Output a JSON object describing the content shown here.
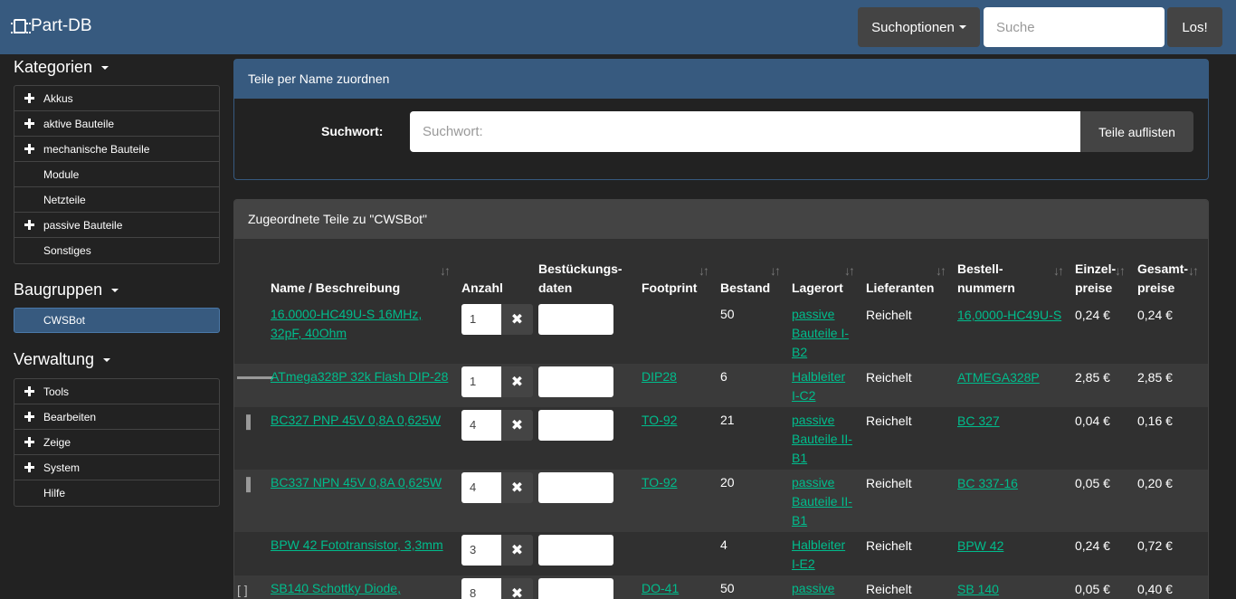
{
  "navbar": {
    "brand": "Part-DB",
    "search_options_label": "Suchoptionen",
    "search_placeholder": "Suche",
    "go_label": "Los!"
  },
  "sidebar": {
    "categories_title": "Kategorien",
    "categories": [
      {
        "label": "Akkus",
        "expandable": true
      },
      {
        "label": "aktive Bauteile",
        "expandable": true
      },
      {
        "label": "mechanische Bauteile",
        "expandable": true
      },
      {
        "label": "Module",
        "expandable": false
      },
      {
        "label": "Netzteile",
        "expandable": false
      },
      {
        "label": "passive Bauteile",
        "expandable": true
      },
      {
        "label": "Sonstiges",
        "expandable": false
      }
    ],
    "assemblies_title": "Baugruppen",
    "assemblies": [
      {
        "label": "CWSBot",
        "active": true
      }
    ],
    "admin_title": "Verwaltung",
    "admin": [
      {
        "label": "Tools",
        "expandable": true
      },
      {
        "label": "Bearbeiten",
        "expandable": true
      },
      {
        "label": "Zeige",
        "expandable": true
      },
      {
        "label": "System",
        "expandable": true
      },
      {
        "label": "Hilfe",
        "expandable": false
      }
    ]
  },
  "assign_panel": {
    "title": "Teile per Name zuordnen",
    "search_label": "Suchwort:",
    "search_placeholder": "Suchwort:",
    "list_button": "Teile auflisten"
  },
  "parts_panel": {
    "title": "Zugeordnete Teile zu \"CWSBot\"",
    "columns": {
      "name": "Name / Beschreibung",
      "qty": "Anzahl",
      "mount_1": "Bestückungs-",
      "mount_2": "daten",
      "footprint": "Footprint",
      "stock": "Bestand",
      "location": "Lagerort",
      "supplier": "Lieferanten",
      "order_1": "Bestell-",
      "order_2": "nummern",
      "unit_1": "Einzel-",
      "unit_2": "preise",
      "total_1": "Gesamt-",
      "total_2": "preise"
    },
    "rows": [
      {
        "name": "16.0000-HC49U-S 16MHz, 32pF, 40Ohm",
        "qty": "1",
        "footprint": "",
        "stock": "50",
        "location": "passive Bauteile I-B2",
        "supplier": "Reichelt",
        "order": "16,0000-HC49U-S",
        "unit": "0,24 €",
        "total": "0,24 €"
      },
      {
        "name": "ATmega328P 32k Flash DIP-28",
        "qty": "1",
        "footprint": "DIP28",
        "stock": "6",
        "location": "Halbleiter I-C2",
        "supplier": "Reichelt",
        "order": "ATMEGA328P",
        "unit": "2,85 €",
        "total": "2,85 €"
      },
      {
        "name": "BC327 PNP 45V 0,8A 0,625W",
        "qty": "4",
        "footprint": "TO-92",
        "stock": "21",
        "location": "passive Bauteile II-B1",
        "supplier": "Reichelt",
        "order": "BC 327",
        "unit": "0,04 €",
        "total": "0,16 €"
      },
      {
        "name": "BC337 NPN 45V 0,8A 0,625W",
        "qty": "4",
        "footprint": "TO-92",
        "stock": "20",
        "location": "passive Bauteile II-B1",
        "supplier": "Reichelt",
        "order": "BC 337-16",
        "unit": "0,05 €",
        "total": "0,20 €"
      },
      {
        "name": "BPW 42 Fototransistor, 3,3mm",
        "qty": "3",
        "footprint": "",
        "stock": "4",
        "location": "Halbleiter I-E2",
        "supplier": "Reichelt",
        "order": "BPW 42",
        "unit": "0,24 €",
        "total": "0,72 €"
      },
      {
        "name": "SB140 Schottky Diode,",
        "qty": "8",
        "footprint": "DO-41",
        "stock": "50",
        "location": "passive",
        "supplier": "Reichelt",
        "order": "SB 140",
        "unit": "0,05 €",
        "total": "0,40 €"
      }
    ]
  }
}
